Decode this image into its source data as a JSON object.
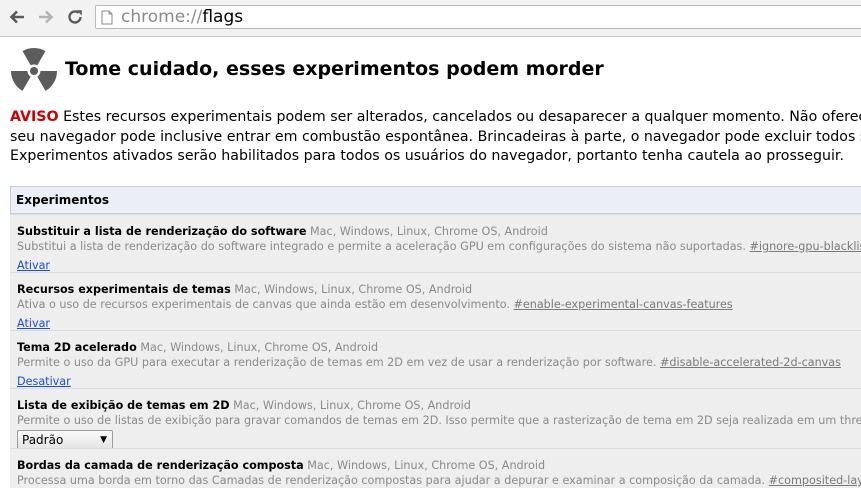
{
  "toolbar": {
    "back_icon": "back-arrow-icon",
    "forward_icon": "forward-arrow-icon",
    "reload_icon": "reload-icon",
    "page_icon": "page-icon",
    "url_scheme": "chrome://",
    "url_host": "flags"
  },
  "header": {
    "icon": "radiation-warning-icon",
    "title": "Tome cuidado, esses experimentos podem morder",
    "warning_label": "AVISO",
    "line1": " Estes recursos experimentais podem ser alterados, cancelados ou desaparecer a qualquer momento. Não oferecemos qua",
    "line2": "seu navegador pode inclusive entrar em combustão espontânea. Brincadeiras à parte, o navegador pode excluir todos seus dados",
    "line3": "Experimentos ativados serão habilitados para todos os usuários do navegador, portanto tenha cautela ao prosseguir."
  },
  "experiments": {
    "header": "Experimentos",
    "items": [
      {
        "name": "Substituir a lista de renderização do software",
        "platforms": " Mac, Windows, Linux, Chrome OS, Android",
        "description": "Substitui a lista de renderização do software integrado e permite a aceleração GPU em configurações do sistema não suportadas. ",
        "permalink": "#ignore-gpu-blacklist",
        "action": "Ativar"
      },
      {
        "name": "Recursos experimentais de temas",
        "platforms": " Mac, Windows, Linux, Chrome OS, Android",
        "description": "Ativa o uso de recursos experimentais de canvas que ainda estão em desenvolvimento. ",
        "permalink": "#enable-experimental-canvas-features",
        "action": "Ativar"
      },
      {
        "name": "Tema 2D acelerado",
        "platforms": " Mac, Windows, Linux, Chrome OS, Android",
        "description": "Permite o uso da GPU para executar a renderização de temas em 2D em vez de usar a renderização por software. ",
        "permalink": "#disable-accelerated-2d-canvas",
        "action": "Desativar"
      },
      {
        "name": "Lista de exibição de temas em 2D",
        "platforms": " Mac, Windows, Linux, Chrome OS, Android",
        "description": "Permite o uso de listas de exibição para gravar comandos de temas em 2D. Isso permite que a rasterização de tema em 2D seja realizada em um thread separado. ",
        "permalink": "#",
        "select_value": "Padrão"
      },
      {
        "name": "Bordas da camada de renderização composta",
        "platforms": " Mac, Windows, Linux, Chrome OS, Android",
        "description": "Processa uma borda em torno das Camadas de renderização compostas para ajudar a depurar e examinar a composição da camada. ",
        "permalink": "#composited-layer-borders"
      }
    ]
  }
}
